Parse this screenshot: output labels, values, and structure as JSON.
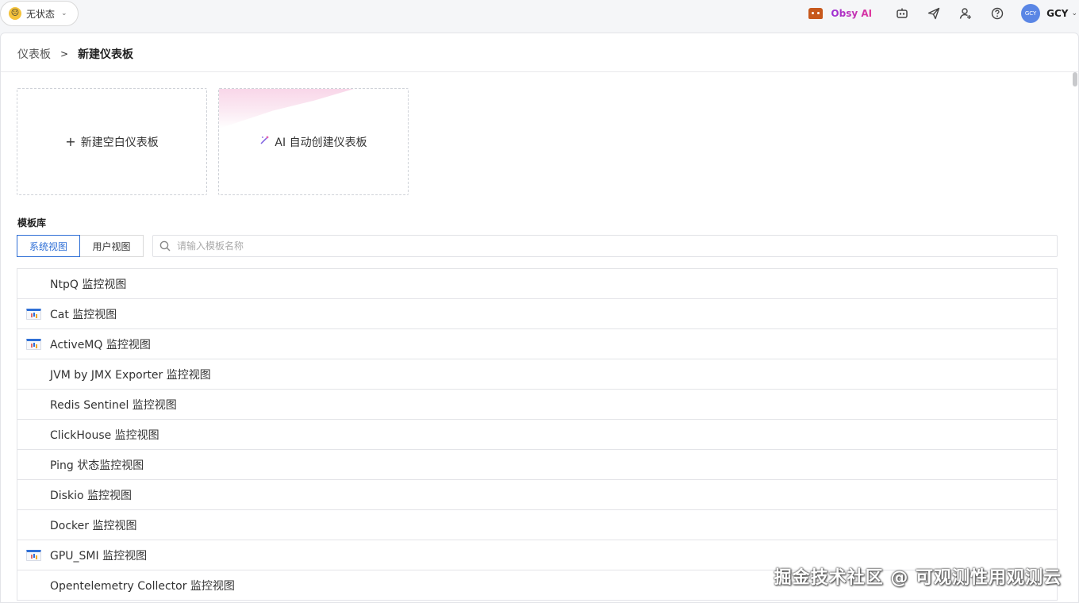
{
  "status": {
    "emoji": "😐",
    "label": "无状态"
  },
  "topbar": {
    "ai_label": "Obsy AI",
    "user_initials": "GCY",
    "user_name": "GCY"
  },
  "breadcrumb": {
    "parent": "仪表板",
    "current": "新建仪表板"
  },
  "cards": {
    "blank_label": "新建空白仪表板",
    "ai_label": "AI 自动创建仪表板"
  },
  "library": {
    "title": "模板库",
    "tabs": [
      {
        "label": "系统视图"
      },
      {
        "label": "用户视图"
      }
    ],
    "search_placeholder": "请输入模板名称",
    "items": [
      {
        "name": "NtpQ 监控视图",
        "has_icon": false
      },
      {
        "name": "Cat 监控视图",
        "has_icon": true
      },
      {
        "name": "ActiveMQ 监控视图",
        "has_icon": true
      },
      {
        "name": "JVM by JMX Exporter 监控视图",
        "has_icon": false
      },
      {
        "name": "Redis Sentinel 监控视图",
        "has_icon": false
      },
      {
        "name": "ClickHouse 监控视图",
        "has_icon": false
      },
      {
        "name": "Ping 状态监控视图",
        "has_icon": false
      },
      {
        "name": "Diskio 监控视图",
        "has_icon": false
      },
      {
        "name": "Docker 监控视图",
        "has_icon": false
      },
      {
        "name": "GPU_SMI 监控视图",
        "has_icon": true
      },
      {
        "name": "Opentelemetry Collector 监控视图",
        "has_icon": false
      }
    ]
  },
  "watermark": "掘金技术社区 @ 可观测性用观测云",
  "colors": {
    "accent": "#2f6fd6",
    "ai_gradient_start": "#9b2fd6",
    "ai_gradient_end": "#e0359b"
  }
}
